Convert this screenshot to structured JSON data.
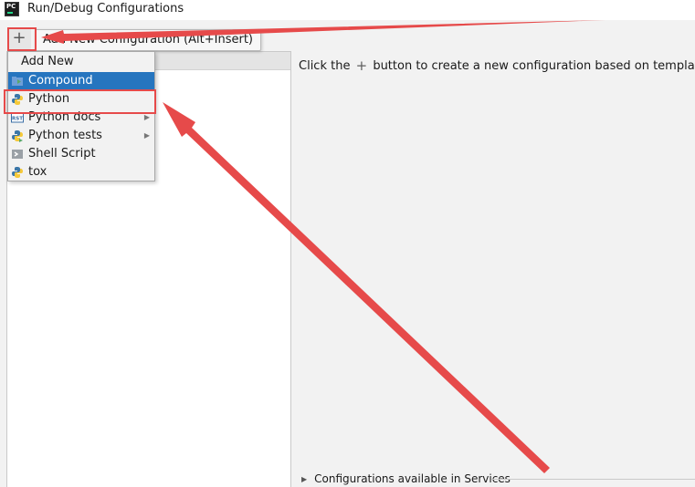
{
  "window": {
    "title": "Run/Debug Configurations",
    "logo_text": "PC"
  },
  "toolbar": {
    "add_glyph": "+",
    "add_tooltip": "Add New Configuration (Alt+Insert)"
  },
  "popup": {
    "header": "Add New Configuration",
    "items": [
      {
        "label": "Compound",
        "icon": "compound-icon",
        "selected": true,
        "submenu": false
      },
      {
        "label": "Python",
        "icon": "python-icon",
        "selected": false,
        "submenu": false
      },
      {
        "label": "Python docs",
        "icon": "rst-docs-icon",
        "selected": false,
        "submenu": true
      },
      {
        "label": "Python tests",
        "icon": "python-tests-icon",
        "selected": false,
        "submenu": true
      },
      {
        "label": "Shell Script",
        "icon": "shell-script-icon",
        "selected": false,
        "submenu": false
      },
      {
        "label": "tox",
        "icon": "tox-icon",
        "selected": false,
        "submenu": false
      }
    ],
    "submenu_glyph": "▶"
  },
  "hint": {
    "before": "Click the",
    "plus_glyph": "+",
    "after": "button to create a new configuration based on templates"
  },
  "services": {
    "expand_glyph": "▶",
    "label": "Configurations available in Services"
  },
  "colors": {
    "selection": "#2675bf",
    "annotation": "#e64a4a",
    "background": "#f2f2f2"
  }
}
